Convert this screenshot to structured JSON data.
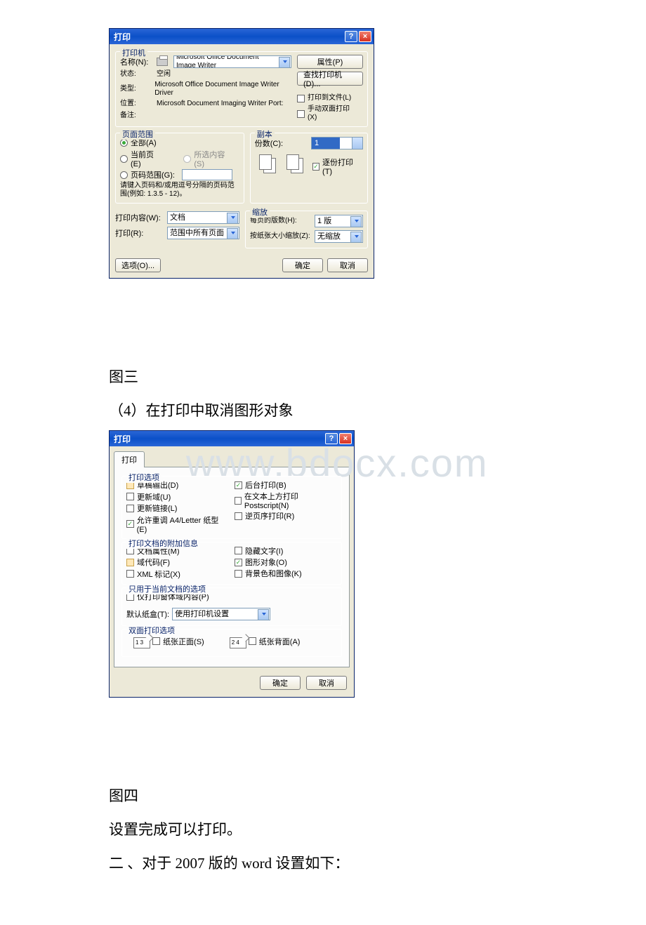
{
  "dialog1": {
    "title": "打印",
    "printer_section": "打印机",
    "name_lbl": "名称(N):",
    "name_val": "Microsoft Office Document Image Writer",
    "status_lbl": "状态:",
    "status_val": "空闲",
    "type_lbl": "类型:",
    "type_val": "Microsoft Office Document Image Writer Driver",
    "location_lbl": "位置:",
    "location_val": "Microsoft Document Imaging Writer Port:",
    "comment_lbl": "备注:",
    "properties_btn": "属性(P)",
    "find_btn": "查找打印机(D)...",
    "print_to_file": "打印到文件(L)",
    "manual_duplex": "手动双面打印(X)",
    "range_section": "页面范围",
    "all": "全部(A)",
    "current": "当前页(E)",
    "selection": "所选内容(S)",
    "pages_lbl": "页码范围(G):",
    "pages_hint": "请键入页码和/或用逗号分隔的页码范围(例如: 1.3.5 - 12)。",
    "copies_section": "副本",
    "copies_lbl": "份数(C):",
    "copies_val": "1",
    "collate": "逐份打印(T)",
    "print_what_lbl": "打印内容(W):",
    "print_what_val": "文档",
    "print_lbl": "打印(R):",
    "print_val": "范围中所有页面",
    "zoom_section": "缩放",
    "pages_per_lbl": "每页的版数(H):",
    "pages_per_val": "1 版",
    "scale_lbl": "按纸张大小缩放(Z):",
    "scale_val": "无缩放",
    "options_btn": "选项(O)...",
    "ok": "确定",
    "cancel": "取消"
  },
  "caption1": "图三",
  "para1": "（4）在打印中取消图形对象",
  "watermark": "www.bdocx.com",
  "dialog2": {
    "title": "打印",
    "tab": "打印",
    "opts_section": "打印选项",
    "draft": "草稿输出(D)",
    "update_fields": "更新域(U)",
    "update_links": "更新链接(L)",
    "allow_a4": "允许重调 A4/Letter 纸型(E)",
    "background": "后台打印(B)",
    "ps_over_text": "在文本上方打印 Postscript(N)",
    "reverse": "逆页序打印(R)",
    "include_section": "打印文档的附加信息",
    "doc_props": "文档属性(M)",
    "field_codes": "域代码(F)",
    "xml_tags": "XML 标记(X)",
    "hidden_text": "隐藏文字(I)",
    "drawings": "图形对象(O)",
    "bg_colors": "背景色和图像(K)",
    "curdoc_section": "只用于当前文档的选项",
    "forms_only": "仅打印窗体域内容(P)",
    "tray_lbl": "默认纸盒(T):",
    "tray_val": "使用打印机设置",
    "duplex_section": "双面打印选项",
    "front": "纸张正面(S)",
    "back": "纸张背面(A)",
    "ok": "确定",
    "cancel": "取消"
  },
  "caption2": "图四",
  "para2": "设置完成可以打印。",
  "para3": "二 、对于 2007 版的 word 设置如下："
}
